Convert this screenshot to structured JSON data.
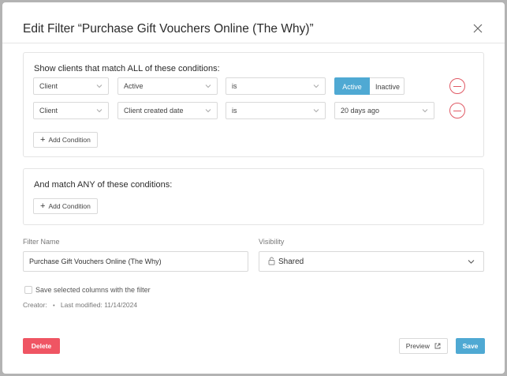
{
  "dialog": {
    "title": "Edit Filter “Purchase Gift Vouchers Online (The Why)”"
  },
  "all_conditions": {
    "title": "Show clients that match ALL of these conditions:",
    "rows": [
      {
        "field": "Client",
        "property": "Active",
        "operator": "is",
        "toggle": [
          "Active",
          "Inactive"
        ],
        "selected": "Active"
      },
      {
        "field": "Client",
        "property": "Client created date",
        "operator": "is",
        "value": "20 days ago"
      }
    ],
    "add_label": "Add Condition"
  },
  "any_conditions": {
    "title": "And match ANY of these conditions:",
    "add_label": "Add Condition"
  },
  "filter_name": {
    "label": "Filter Name",
    "value": "Purchase Gift Vouchers Online (The Why)"
  },
  "visibility": {
    "label": "Visibility",
    "value": "Shared",
    "icon": "lock-icon"
  },
  "save_columns": {
    "label": "Save selected columns with the filter",
    "checked": false
  },
  "meta": {
    "creator": "Creator:",
    "separator": "•",
    "last_modified": "Last modified: 11/14/2024"
  },
  "footer": {
    "delete_label": "Delete",
    "preview_label": "Preview",
    "save_label": "Save"
  },
  "colors": {
    "primary": "#4fa9d3",
    "danger": "#ef5563"
  }
}
